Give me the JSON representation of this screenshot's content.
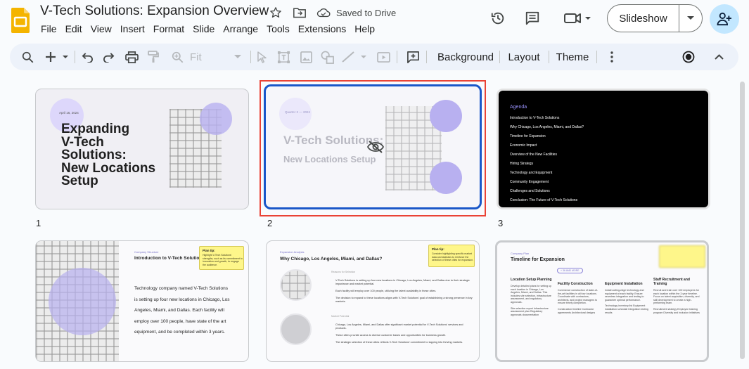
{
  "window": {
    "doc_title": "V-Tech Solutions: Expansion Overview",
    "saved_status": "Saved to Drive"
  },
  "menu": [
    "File",
    "Edit",
    "View",
    "Insert",
    "Format",
    "Slide",
    "Arrange",
    "Tools",
    "Extensions",
    "Help"
  ],
  "header_actions": {
    "slideshow_label": "Slideshow"
  },
  "toolbar": {
    "zoom_label": "Fit",
    "background_label": "Background",
    "layout_label": "Layout",
    "theme_label": "Theme"
  },
  "colors": {
    "accent": "#1a57c8",
    "selection_outline": "#ea4335",
    "lavender": "#c9c2f2",
    "purple": "#b8b0f0",
    "note_yellow": "#fef68a"
  },
  "slides": [
    {
      "number": "1",
      "date": "April 16, 2024",
      "title_lines": [
        "Expanding",
        "V-Tech",
        "Solutions:",
        "New Locations",
        "Setup"
      ]
    },
    {
      "number": "2",
      "tag": "Quarter 2 — 2024",
      "title": "V-Tech Solutions:",
      "subtitle": "New Locations Setup"
    },
    {
      "number": "3",
      "heading": "Agenda",
      "items": [
        "Introduction to V-Tech Solutions",
        "Why Chicago, Los Angeles, Miami, and Dallas?",
        "Timeline for Expansion",
        "Economic Impact",
        "Overview of the New Facilities",
        "Hiring Strategy",
        "Technology and Equipment",
        "Community Engagement",
        "Challenges and Solutions",
        "Conclusion: The Future of V-Tech Solutions"
      ]
    },
    {
      "number": "4",
      "eyebrow": "Company Structure",
      "title": "Introduction to V-Tech Solutions",
      "note_title": "Plan tip:",
      "note_text": "Highlight V-Tech Solutions' strengths, such as its commitment to innovation and growth, to engage the audience.",
      "body_lines": [
        "Technology company named V-Tech Solutions",
        "is setting up four new locations in Chicago, Los",
        "Angeles, Miami, and Dallas. Each facility will",
        "employ over 100 people, have state of the art",
        "equipment, and be completed within 3 years."
      ]
    },
    {
      "number": "5",
      "eyebrow": "Expansion Analysis",
      "title": "Why Chicago, Los Angeles, Miami, and Dallas?",
      "note_title": "Plan tip:",
      "note_text": "Consider highlighting specific market data and statistics to reinforce the selection of these cities for expansion.",
      "section1_label": "Reasons for Selection",
      "section1_bullets": [
        "V-Tech Solutions is setting up four new locations in Chicago, Los Angeles, Miami, and Dallas due to their strategic importance and market potential.",
        "Each facility will employ over 100 people, utilizing the talent availability in these cities.",
        "The decision to expand to these locations aligns with V-Tech Solutions' goal of establishing a strong presence in key markets."
      ],
      "section2_label": "Market Potential",
      "section2_bullets": [
        "Chicago, Los Angeles, Miami, and Dallas offer significant market potential for V-Tech Solutions' services and products.",
        "These cities provide access to diverse customer bases and opportunities for business growth.",
        "The strategic selection of these cities reflects V-Tech Solutions' commitment to tapping into thriving markets."
      ]
    },
    {
      "number": "6",
      "eyebrow": "Company Plan",
      "title": "Timeline for Expansion",
      "pill": "+ 36 AND MORE",
      "columns": [
        {
          "heading": "Location Setup Planning",
          "text": "Develop detailed plans for setting up each location in Chicago, Los Angeles, Miami, and Dallas. This includes site selection, infrastructure assessment, and regulatory approvals.",
          "deliverables": "Site selection report Infrastructure assessment plan Regulatory approvals documentation"
        },
        {
          "heading": "Facility Construction",
          "text": "Commence construction of state-of-the-art facilities in all four locations. Coordinate with contractors, architects, and project managers to ensure timely completion.",
          "deliverables": "Construction timeline Contractor agreements Architectural designs"
        },
        {
          "heading": "Equipment Installation",
          "text": "Install cutting-edge technology and equipment at each facility. Ensure seamless integration and testing to guarantee optimal performance.",
          "deliverables": "Technology inventory list Equipment installation schedule Integration testing results"
        },
        {
          "heading": "Staff Recruitment and Training",
          "text": "Recruit and train over 100 employees for each location within the 3-year timeline. Focus on talent acquisition, diversity, and skill development to create a high-performing team.",
          "deliverables": "Recruitment strategy Employee training program Diversity and inclusion initiatives"
        }
      ]
    }
  ]
}
